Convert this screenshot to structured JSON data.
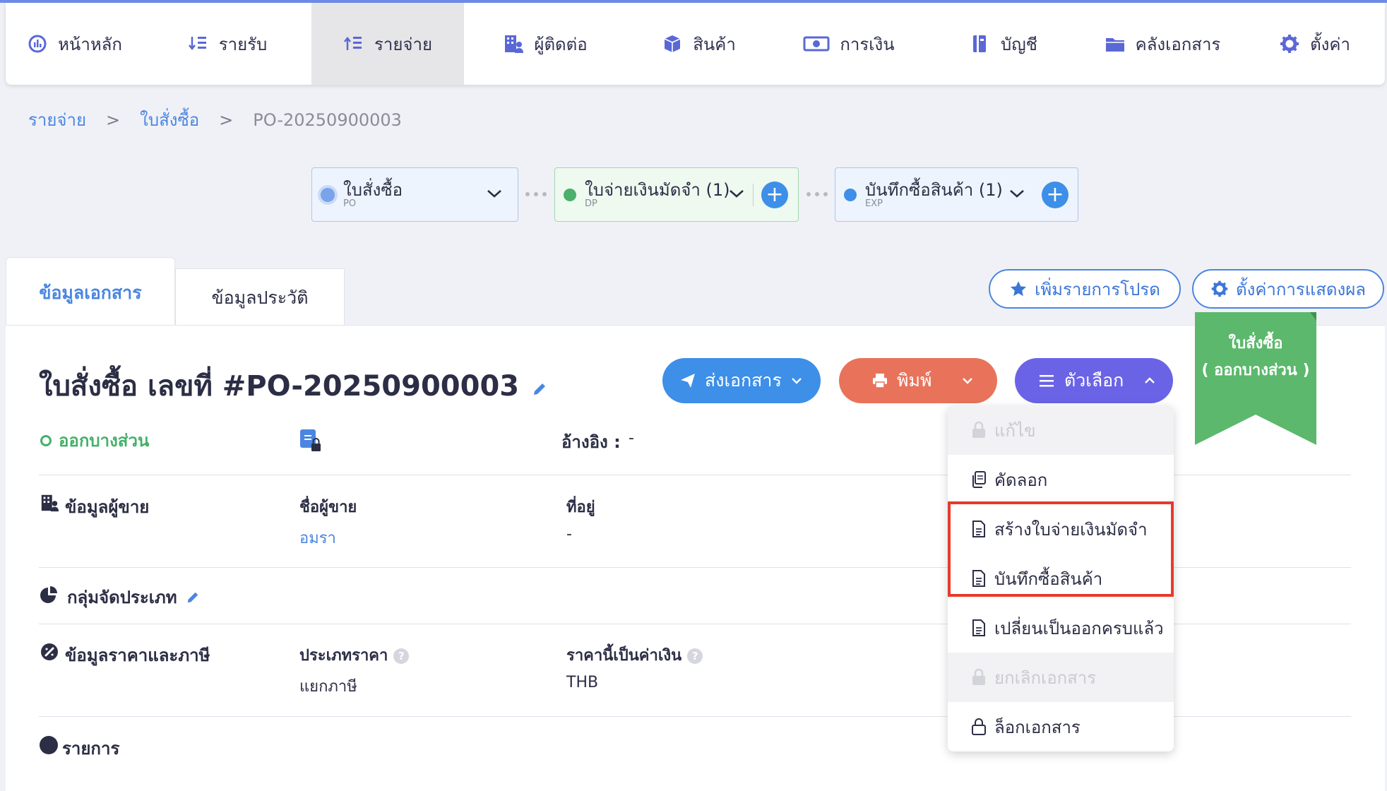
{
  "nav": {
    "items": [
      {
        "label": "หน้าหลัก",
        "icon": "dashboard-icon",
        "active": false
      },
      {
        "label": "รายรับ",
        "icon": "income-list-icon",
        "active": false
      },
      {
        "label": "รายจ่าย",
        "icon": "expense-list-icon",
        "active": true
      },
      {
        "label": "ผู้ติดต่อ",
        "icon": "contacts-building-icon",
        "active": false
      },
      {
        "label": "สินค้า",
        "icon": "box-icon",
        "active": false
      },
      {
        "label": "การเงิน",
        "icon": "money-icon",
        "active": false
      },
      {
        "label": "บัญชี",
        "icon": "ledger-icon",
        "active": false
      },
      {
        "label": "คลังเอกสาร",
        "icon": "folder-icon",
        "active": false
      },
      {
        "label": "ตั้งค่า",
        "icon": "gear-icon",
        "active": false
      }
    ]
  },
  "breadcrumb": {
    "root": "รายจ่าย",
    "parent": "ใบสั่งซื้อ",
    "current": "PO-20250900003",
    "separator": ">"
  },
  "steps": [
    {
      "label": "ใบสั่งซื้อ",
      "code": "PO"
    },
    {
      "label": "ใบจ่ายเงินมัดจำ (1)",
      "code": "DP"
    },
    {
      "label": "บันทึกซื้อสินค้า (1)",
      "code": "EXP"
    }
  ],
  "tabs": {
    "doc_info": "ข้อมูลเอกสาร",
    "history": "ข้อมูลประวัติ"
  },
  "actions": {
    "favorite": "เพิ่มรายการโปรด",
    "display_settings": "ตั้งค่าการแสดงผล"
  },
  "ribbon": {
    "line1": "ใบสั่งซื้อ",
    "line2": "( ออกบางส่วน )"
  },
  "doc": {
    "title": "ใบสั่งซื้อ เลขที่ #PO-20250900003",
    "status": "ออกบางส่วน",
    "reference_label": "อ้างอิง :",
    "reference_value": "-"
  },
  "buttons": {
    "send": "ส่งเอกสาร",
    "print": "พิมพ์",
    "options": "ตัวเลือก"
  },
  "seller": {
    "section": "ข้อมูลผู้ขาย",
    "name_label": "ชื่อผู้ขาย",
    "name_value": "อมรา",
    "address_label": "ที่อยู่",
    "address_value": "-"
  },
  "group": {
    "section": "กลุ่มจัดประเภท"
  },
  "price": {
    "section": "ข้อมูลราคาและภาษี",
    "type_label": "ประเภทราคา",
    "type_value": "แยกภาษี",
    "currency_label": "ราคานี้เป็นค่าเงิน",
    "currency_value": "THB"
  },
  "items": {
    "section": "รายการ"
  },
  "menu": [
    {
      "label": "แก้ไข",
      "disabled": true,
      "icon": "lock-icon"
    },
    {
      "label": "คัดลอก",
      "disabled": false,
      "icon": "copy-icon"
    },
    {
      "label": "สร้างใบจ่ายเงินมัดจำ",
      "disabled": false,
      "icon": "document-icon"
    },
    {
      "label": "บันทึกซื้อสินค้า",
      "disabled": false,
      "icon": "document-icon"
    },
    {
      "label": "เปลี่ยนเป็นออกครบแล้ว",
      "disabled": false,
      "icon": "document-icon"
    },
    {
      "label": "ยกเลิกเอกสาร",
      "disabled": true,
      "icon": "lock-icon"
    },
    {
      "label": "ล็อกเอกสาร",
      "disabled": false,
      "icon": "lock-outline-icon"
    }
  ],
  "colors": {
    "primary": "#4b86e0",
    "send": "#3d8fe8",
    "print": "#e8735a",
    "options": "#6b63e6",
    "success": "#45b06a",
    "highlight": "#e53b2c"
  }
}
